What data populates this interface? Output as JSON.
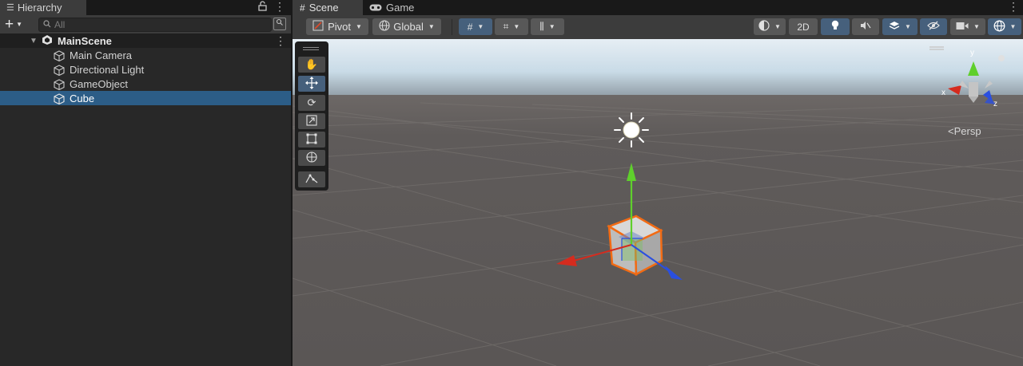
{
  "hierarchy": {
    "tab_title": "Hierarchy",
    "add_label": "+",
    "search_placeholder": "All",
    "scene_name": "MainScene",
    "items": [
      {
        "label": "Main Camera",
        "selected": false
      },
      {
        "label": "Directional Light",
        "selected": false
      },
      {
        "label": "GameObject",
        "selected": false
      },
      {
        "label": "Cube",
        "selected": true
      }
    ]
  },
  "scene_view": {
    "tabs": [
      {
        "label": "Scene",
        "icon": "grid-icon",
        "active": true
      },
      {
        "label": "Game",
        "icon": "gamepad-icon",
        "active": false
      }
    ],
    "toolbar": {
      "pivot_label": "Pivot",
      "global_label": "Global",
      "mode_2d_label": "2D"
    },
    "tools": [
      "hand-tool",
      "move-tool",
      "rotate-tool",
      "scale-tool",
      "rect-tool",
      "transform-tool",
      "custom-editor-tool"
    ],
    "active_tool": "move-tool",
    "gizmo": {
      "axis_x_label": "x",
      "axis_y_label": "y",
      "axis_z_label": "z",
      "projection_label": "Persp"
    },
    "colors": {
      "selection": "#2c5d87",
      "x_axis": "#d52b1e",
      "y_axis": "#5fcf2c",
      "z_axis": "#2a4fe0",
      "outline": "#f26b14",
      "ground": "#5f5b5a",
      "sky": "#c9dbe7"
    }
  }
}
